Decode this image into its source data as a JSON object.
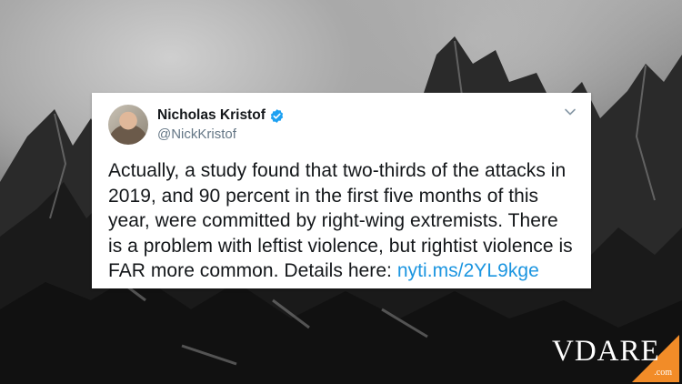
{
  "tweet": {
    "display_name": "Nicholas Kristof",
    "handle": "@NickKristof",
    "text": "Actually, a study found that two-thirds of the attacks in 2019, and 90 percent in the first five months of this year, were committed by right-wing extremists. There is a problem with leftist violence, but rightist violence is FAR more common. Details here: ",
    "link": "nyti.ms/2YL9kge"
  },
  "brand": {
    "name": "VDARE",
    "suffix": ".com"
  },
  "colors": {
    "link": "#1b95e0",
    "verified": "#1da1f2",
    "accent_corner": "#f28c28"
  },
  "icons": {
    "verified": "verified-badge-icon",
    "caret": "chevron-down-icon"
  }
}
